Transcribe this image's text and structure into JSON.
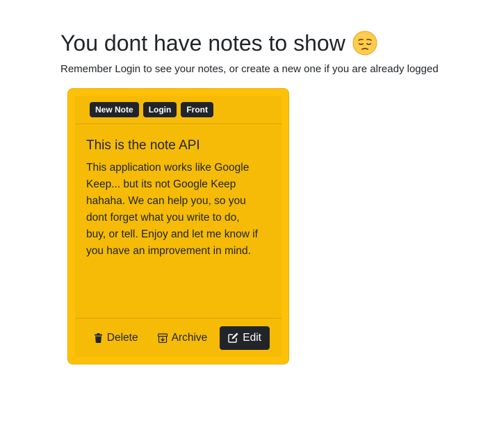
{
  "empty_state": {
    "title": "You dont have notes to show",
    "emoji_icon": "pensive-face-icon",
    "subtitle": "Remember Login to see your notes, or create a new one if you are already logged"
  },
  "note_card": {
    "tags": [
      "New Note",
      "Login",
      "Front"
    ],
    "title": "This is the note API",
    "body": "This application works like Google Keep... but its not Google Keep hahaha. We can help you, so you dont forget what you write to do, buy, or tell. Enjoy and let me know if you have an improvement in mind.",
    "actions": {
      "delete_label": "Delete",
      "archive_label": "Archive",
      "edit_label": "Edit"
    }
  },
  "colors": {
    "card_background": "#ffc107",
    "dark": "#212529"
  }
}
